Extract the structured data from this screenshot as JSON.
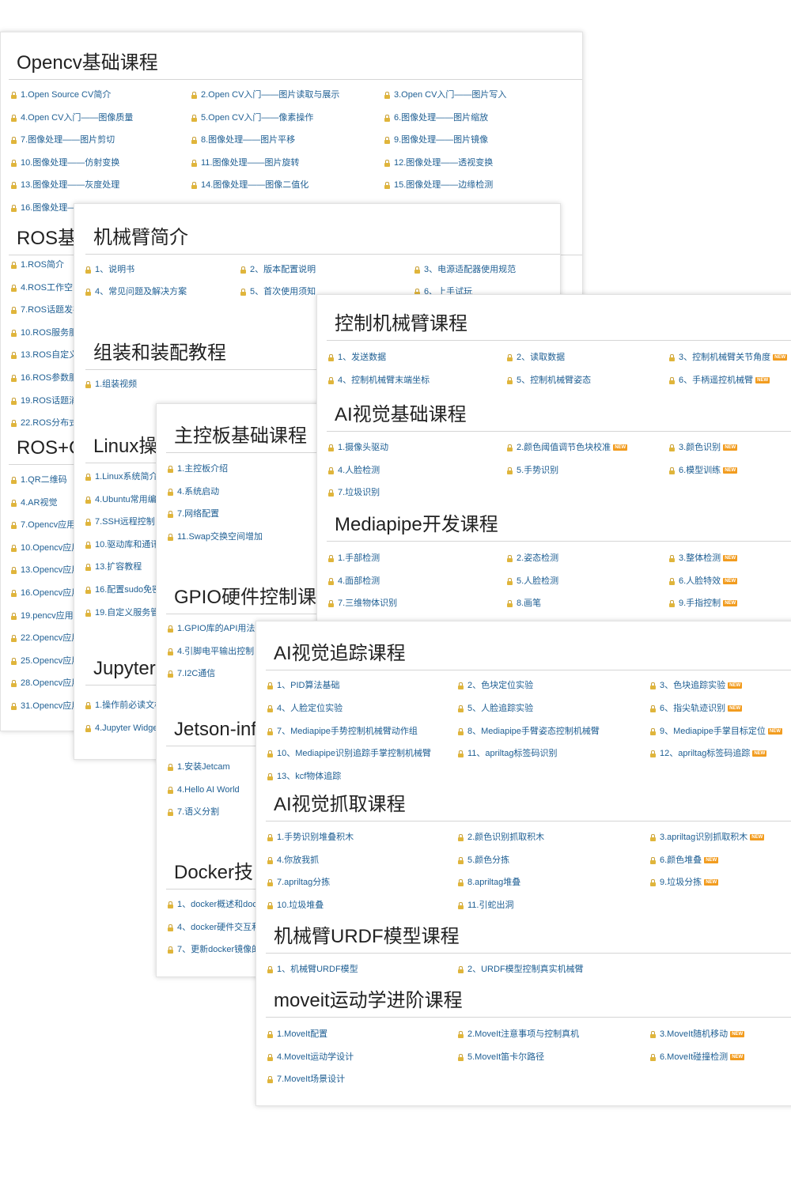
{
  "p1": {
    "s1_title": "Opencv基础课程",
    "s1_items": [
      "1.Open Source CV简介",
      "2.Open CV入门——图片读取与展示",
      "3.Open CV入门——图片写入",
      "4.Open CV入门——图像质量",
      "5.Open CV入门——像素操作",
      "6.图像处理——图片缩放",
      "7.图像处理——图片剪切",
      "8.图像处理——图片平移",
      "9.图像处理——图片镜像",
      "10.图像处理——仿射变换",
      "11.图像处理——图片旋转",
      "12.图像处理——透视变换",
      "13.图像处理——灰度处理",
      "14.图像处理——图像二值化",
      "15.图像处理——边缘检测",
      "16.图像处理——"
    ],
    "s2_title": "ROS基",
    "s2_items": [
      "1.ROS简介",
      "4.ROS工作空间",
      "7.ROS话题发布",
      "10.ROS服务服",
      "13.ROS自定义",
      "16.ROS参数服",
      "19.ROS话题消",
      "22.ROS分布式"
    ],
    "s3_title": "ROS+C",
    "s3_items": [
      "1.QR二维码",
      "4.AR视觉",
      "7.Opencv应用-",
      "10.Opencv应用",
      "13.Opencv应用",
      "16.Opencv应用",
      "19.pencv应用-",
      "22.Opencv应用",
      "25.Opencv应用",
      "28.Opencv应用",
      "31.Opencv应用"
    ]
  },
  "p2": {
    "s1_title": "机械臂简介",
    "s1_items": [
      "1、说明书",
      "2、版本配置说明",
      "3、电源适配器使用规范",
      "4、常见问题及解决方案",
      "5、首次使用须知",
      "6、上手试玩"
    ],
    "s2_title": "组装和装配教程",
    "s2_items": [
      "1.组装视频"
    ],
    "s3_title": "Linux操",
    "s3_items": [
      "1.Linux系统简介",
      "4.Ubuntu常用编",
      "7.SSH远程控制",
      "10.驱动库和通讯",
      "13.扩容教程",
      "16.配置sudo免密",
      "19.自定义服务管"
    ],
    "s4_title": "Jupyter",
    "s4_items": [
      "1.操作前必读文档",
      "4.Jupyter Widge"
    ]
  },
  "p3": {
    "s1_title": "主控板基础课程",
    "s1_items": [
      "1.主控板介绍",
      "4.系统启动",
      "7.网络配置",
      "11.Swap交换空间增加"
    ],
    "s2_title": "GPIO硬件控制课",
    "s2_items": [
      "1.GPIO库的API用法",
      "4.引脚电平输出控制",
      "7.I2C通信"
    ],
    "s3_title": "Jetson-inf",
    "s3_items": [
      "1.安装Jetcam",
      "4.Hello AI World",
      "7.语义分割"
    ],
    "s4_title": "Docker技",
    "s4_items": [
      "1、docker概述和docl",
      "4、docker硬件交互和",
      "7、更新docker镜像的"
    ]
  },
  "p4": {
    "s1_title": "控制机械臂课程",
    "s1_items": [
      "1、发送数据",
      "2、读取数据",
      "3、控制机械臂关节角度",
      "4、控制机械臂末端坐标",
      "5、控制机械臂姿态",
      "6、手柄遥控机械臂"
    ],
    "s2_title": "AI视觉基础课程",
    "s2_items": [
      "1.摄像头驱动",
      "2.颜色阈值调节色块校准",
      "3.颜色识别",
      "4.人脸检测",
      "5.手势识别",
      "6.模型训练",
      "7.垃圾识别"
    ],
    "s3_title": "Mediapipe开发课程",
    "s3_items": [
      "1.手部检测",
      "2.姿态检测",
      "3.整体检测",
      "4.面部检测",
      "5.人脸检测",
      "6.人脸特效",
      "7.三维物体识别",
      "8.画笔",
      "9.手指控制"
    ]
  },
  "p5": {
    "s1_title": "AI视觉追踪课程",
    "s1_items": [
      "1、PID算法基础",
      "2、色块定位实验",
      "3、色块追踪实验",
      "4、人脸定位实验",
      "5、人脸追踪实验",
      "6、指尖轨迹识别",
      "7、Mediapipe手势控制机械臂动作组",
      "8、Mediapipe手臂姿态控制机械臂",
      "9、Mediapipe手掌目标定位",
      "10、Mediapipe识别追踪手掌控制机械臂",
      "11、apriltag标签码识别",
      "12、apriltag标签码追踪",
      "13、kcf物体追踪"
    ],
    "s2_title": "AI视觉抓取课程",
    "s2_items": [
      "1.手势识别堆叠积木",
      "2.颜色识别抓取积木",
      "3.apriltag识别抓取积木",
      "4.你放我抓",
      "5.颜色分拣",
      "6.颜色堆叠",
      "7.apriltag分拣",
      "8.apriltag堆叠",
      "9.垃圾分拣",
      "10.垃圾堆叠",
      "11.引蛇出洞"
    ],
    "s3_title": "机械臂URDF模型课程",
    "s3_items": [
      "1、机械臂URDF模型",
      "2、URDF模型控制真实机械臂"
    ],
    "s4_title": "moveit运动学进阶课程",
    "s4_items": [
      "1.MoveIt配置",
      "2.MoveIt注意事项与控制真机",
      "3.MoveIt随机移动",
      "4.MoveIt运动学设计",
      "5.MoveIt笛卡尔路径",
      "6.MoveIt碰撞检测",
      "7.MoveIt场景设计"
    ]
  },
  "badge_text": "NEW",
  "colors": {
    "link": "#1f5f93",
    "lock": "#e0b53b",
    "badge": "#f29c1f"
  }
}
